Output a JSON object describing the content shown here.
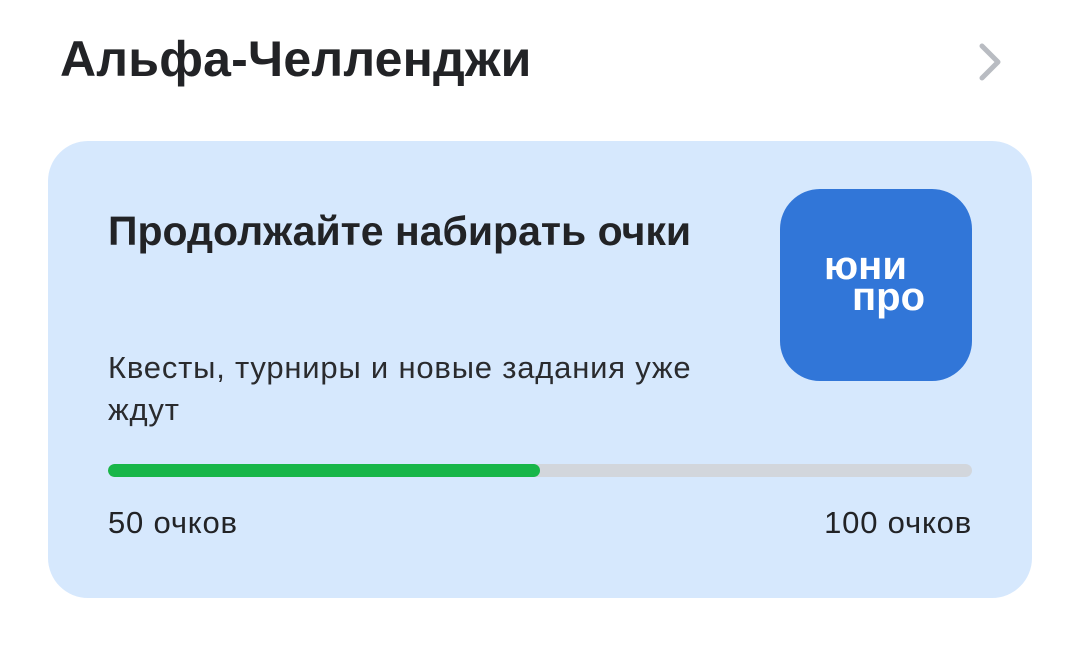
{
  "header": {
    "title": "Альфа-Челленджи"
  },
  "card": {
    "title": "Продолжайте набирать очки",
    "subtitle": "Квесты, турниры и новые задания уже ждут",
    "logo": {
      "line1": "юни",
      "line2": "про",
      "bg_color": "#3176d8"
    },
    "progress": {
      "current_label": "50 очков",
      "max_label": "100 очков",
      "current": 50,
      "max": 100,
      "fill_color": "#18b649",
      "track_color": "#d2d6dc"
    },
    "bg_color": "#d6e8fd"
  },
  "icons": {
    "chevron": "chevron-right-icon"
  }
}
